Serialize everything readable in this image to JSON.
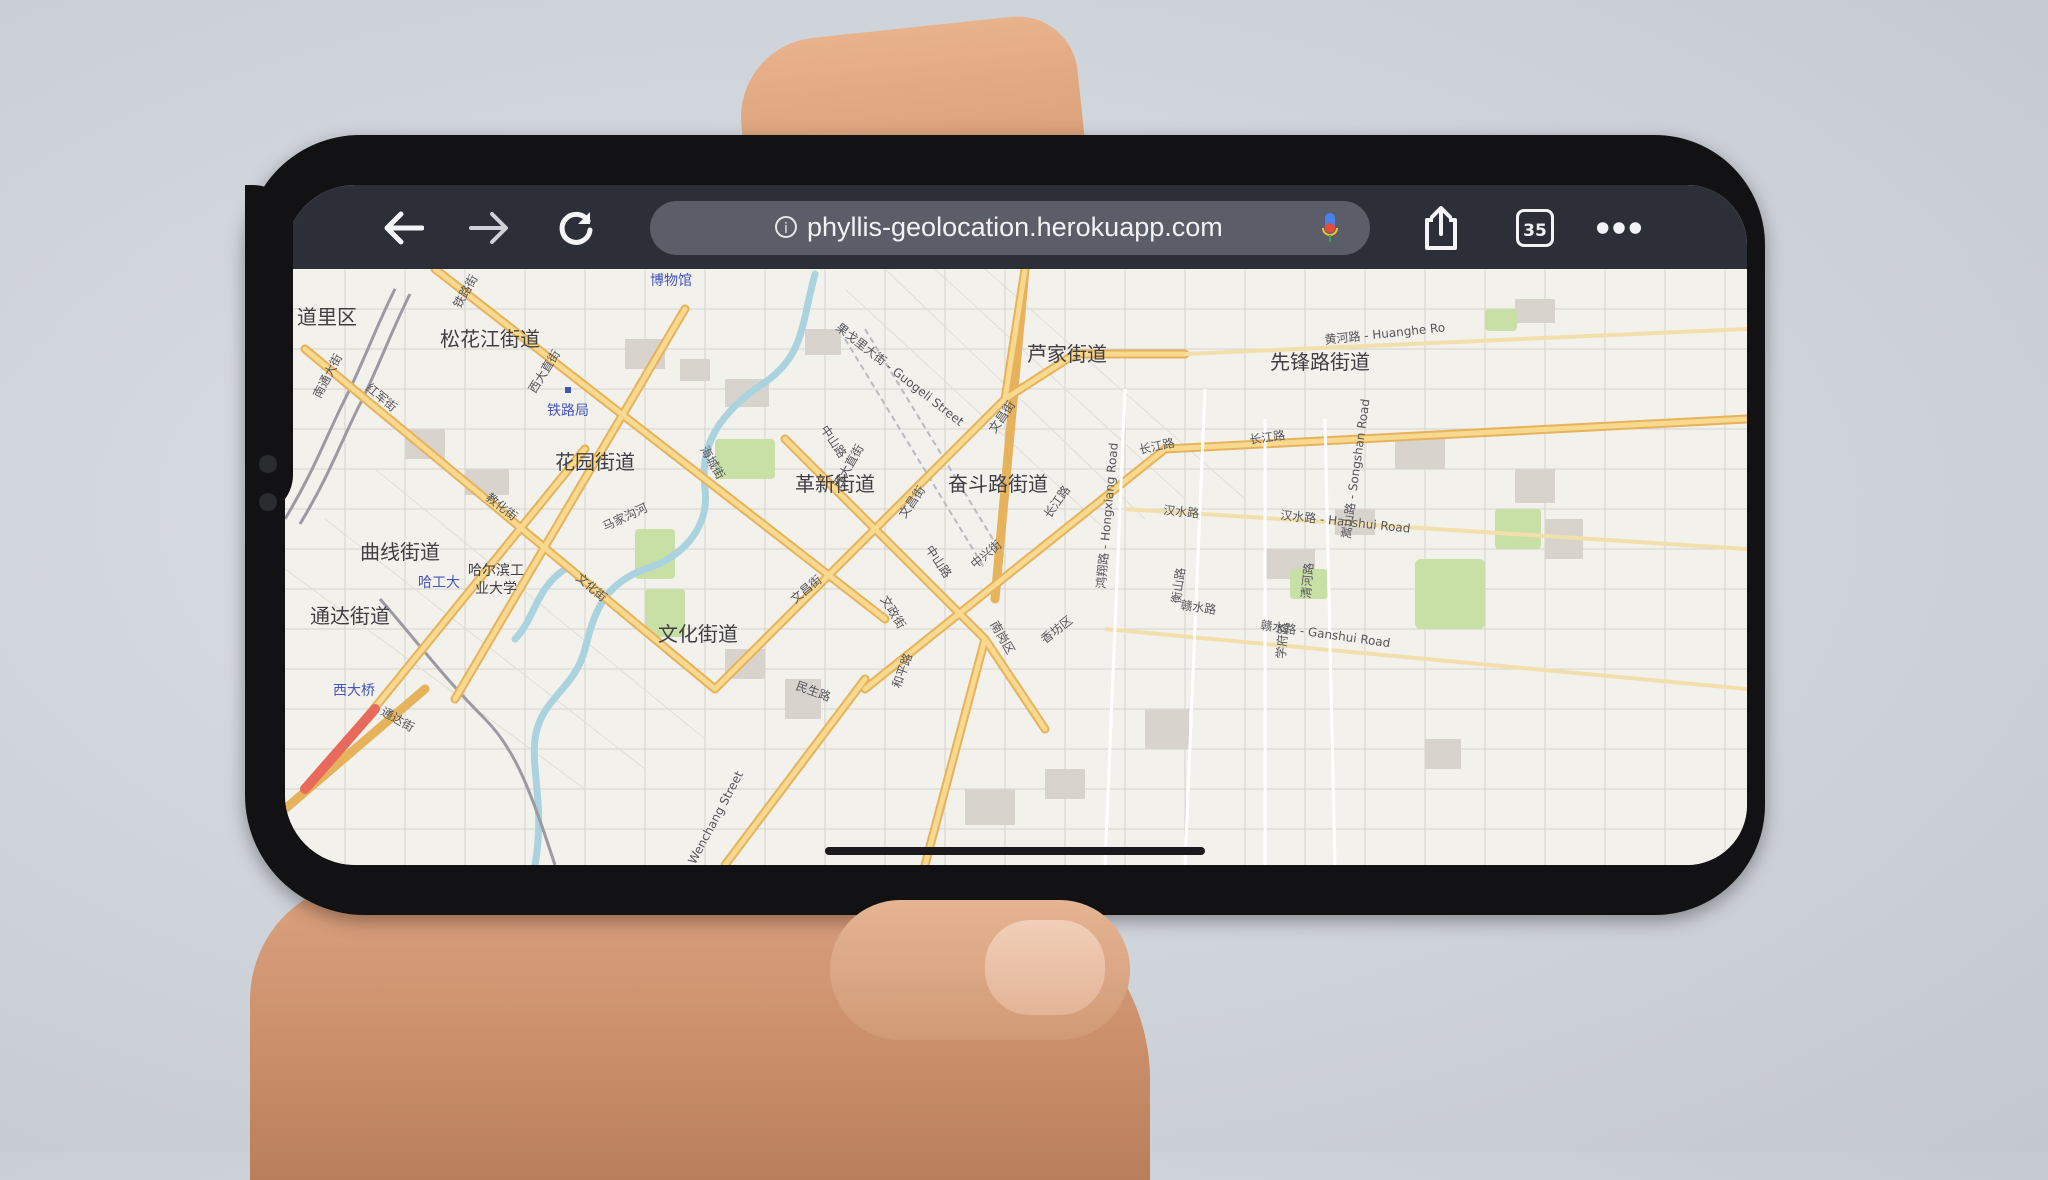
{
  "browser": {
    "url": "phyllis-geolocation.herokuapp.com",
    "tab_count": "35",
    "icons": [
      "back-arrow-icon",
      "forward-arrow-icon",
      "reload-icon",
      "info-icon",
      "microphone-icon",
      "share-icon",
      "tabs-icon",
      "more-icon"
    ]
  },
  "map": {
    "districts": [
      {
        "id": "daoli",
        "label": "道里区"
      },
      {
        "id": "songhuajiang",
        "label": "松花江街道"
      },
      {
        "id": "huayuan",
        "label": "花园街道"
      },
      {
        "id": "quxian",
        "label": "曲线街道"
      },
      {
        "id": "tongda",
        "label": "通达街道"
      },
      {
        "id": "gexin",
        "label": "革新街道"
      },
      {
        "id": "fendoulu",
        "label": "奋斗路街道"
      },
      {
        "id": "lujia",
        "label": "芦家街道"
      },
      {
        "id": "xianfenglu",
        "label": "先锋路街道"
      },
      {
        "id": "wenhua",
        "label": "文化街道"
      }
    ],
    "pois": [
      {
        "id": "museum",
        "label": "博物馆"
      },
      {
        "id": "railway",
        "label": "铁路局"
      },
      {
        "id": "hit",
        "label": "哈工大"
      },
      {
        "id": "xidaqiao",
        "label": "西大桥"
      },
      {
        "id": "hust",
        "label": "哈尔滨工\n业大学"
      }
    ],
    "roads": [
      {
        "id": "guogeli",
        "label": "果戈里大街 - Guogeli Street"
      },
      {
        "id": "zhongshan1",
        "label": "中山路"
      },
      {
        "id": "zhongshan2",
        "label": "中山路"
      },
      {
        "id": "wenchang1",
        "label": "文昌街"
      },
      {
        "id": "wenchang2",
        "label": "文昌街"
      },
      {
        "id": "wenchang3",
        "label": "文昌街"
      },
      {
        "id": "changjiang1",
        "label": "长江路"
      },
      {
        "id": "changjiang2",
        "label": "长江路"
      },
      {
        "id": "changjiang3",
        "label": "长江路"
      },
      {
        "id": "hanshui",
        "label": "汉水路 - Hanshui Road"
      },
      {
        "id": "hanshui2",
        "label": "汉水路"
      },
      {
        "id": "ganshui",
        "label": "赣水路 - Ganshui Road"
      },
      {
        "id": "ganshui2",
        "label": "赣水路"
      },
      {
        "id": "huanghe",
        "label": "黄河路 - Huanghe Ro"
      },
      {
        "id": "hongxiang",
        "label": "鸿翔路 - Hongxiang Road"
      },
      {
        "id": "songshan",
        "label": "嵩山路 - Songshan Road"
      },
      {
        "id": "xidazhi",
        "label": "西大直街"
      },
      {
        "id": "jiaohua",
        "label": "教化街"
      },
      {
        "id": "wenhuajie",
        "label": "文化街"
      },
      {
        "id": "zhongxing",
        "label": "中兴街"
      },
      {
        "id": "heping",
        "label": "和平路"
      },
      {
        "id": "minsheng",
        "label": "民生路"
      },
      {
        "id": "majiagou",
        "label": "马家沟河"
      },
      {
        "id": "haicheng",
        "label": "海城街"
      },
      {
        "id": "wenzhengjie",
        "label": "文政街"
      },
      {
        "id": "hengshan",
        "label": "衡山路"
      },
      {
        "id": "xiangfang",
        "label": "香坊区"
      },
      {
        "id": "nangang",
        "label": "南岗区"
      },
      {
        "id": "nantong",
        "label": "南通大街"
      },
      {
        "id": "hongjun",
        "label": "红军街"
      },
      {
        "id": "xidazhi2",
        "label": "西大直街"
      },
      {
        "id": "qinghe",
        "label": "清河路"
      },
      {
        "id": "tongda",
        "label": "通达街"
      },
      {
        "id": "tieluojie",
        "label": "铁路街"
      },
      {
        "id": "xuefu",
        "label": "学府路"
      },
      {
        "id": "wenchangstreet",
        "label": "Wenchang Street"
      }
    ]
  },
  "colors": {
    "toolbar_bg": "#2c2f38",
    "url_field_bg": "#5b5e68",
    "major_road": "#f0c070",
    "map_bg": "#f3f1ec",
    "park": "#c8dfa6",
    "water": "#aad3df"
  }
}
